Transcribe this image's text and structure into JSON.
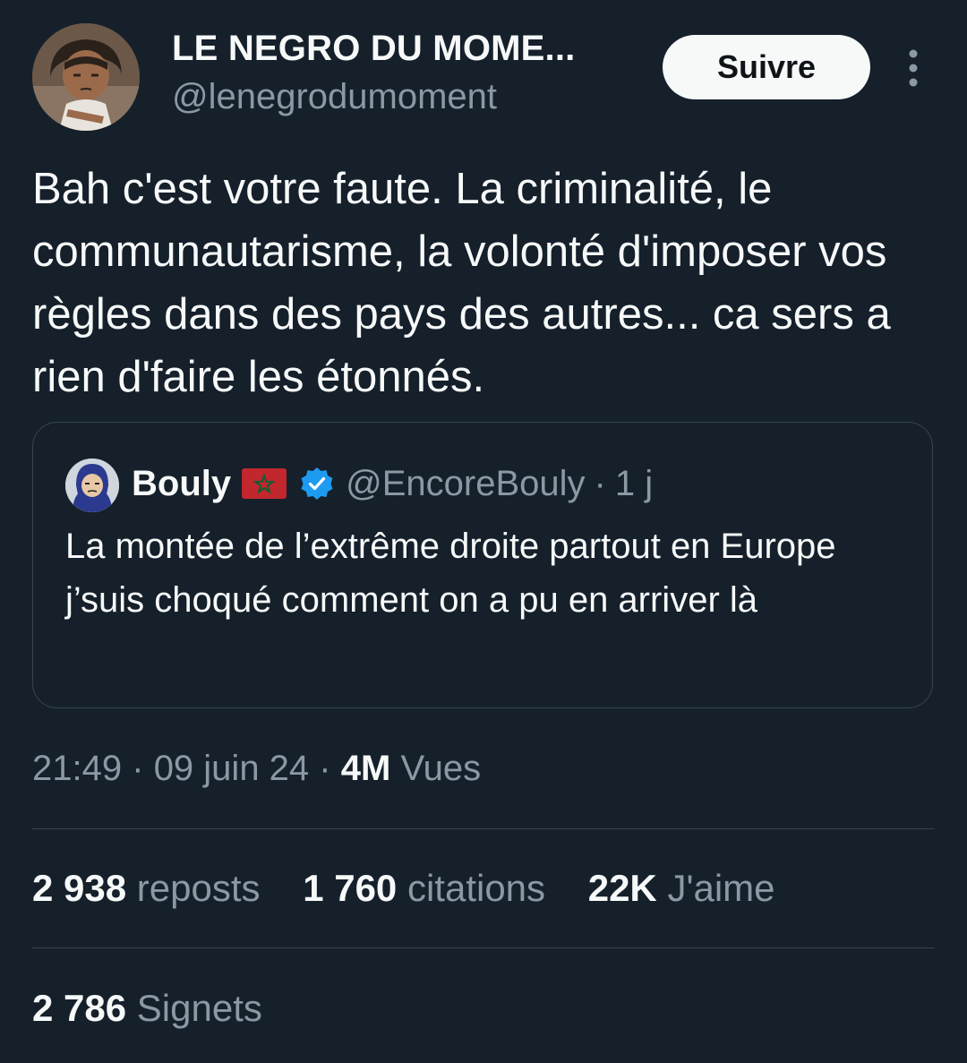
{
  "author": {
    "display_name": "LE NEGRO DU MOME...",
    "handle": "@lenegrodumoment",
    "avatar_icon": "cartoon-avatar"
  },
  "follow_button_label": "Suivre",
  "more_icon": "more-vertical-icon",
  "tweet_text": "Bah c'est votre faute. La criminalité, le communautarisme, la volonté d'imposer vos règles dans des pays des autres... ca sers a rien d'faire les étonnés.",
  "quote": {
    "name": "Bouly",
    "flag_icon": "morocco-flag-icon",
    "verified_icon": "verified-badge-icon",
    "handle": "@EncoreBouly",
    "separator": "·",
    "time": "1 j",
    "text": "La montée de l’extrême droite partout en Europe j’suis choqué comment on a pu en arriver là"
  },
  "meta": {
    "time": "21:49",
    "date": "09 juin 24",
    "separator": "·",
    "views_count": "4M",
    "views_label": "Vues"
  },
  "stats": {
    "reposts_count": "2 938",
    "reposts_label": "reposts",
    "quotes_count": "1 760",
    "quotes_label": "citations",
    "likes_count": "22K",
    "likes_label": "J'aime",
    "bookmarks_count": "2 786",
    "bookmarks_label": "Signets"
  },
  "colors": {
    "background": "#15202b",
    "text": "#f7f9f9",
    "secondary": "#8b98a5",
    "border": "#38444d",
    "verified": "#1d9bf0"
  }
}
